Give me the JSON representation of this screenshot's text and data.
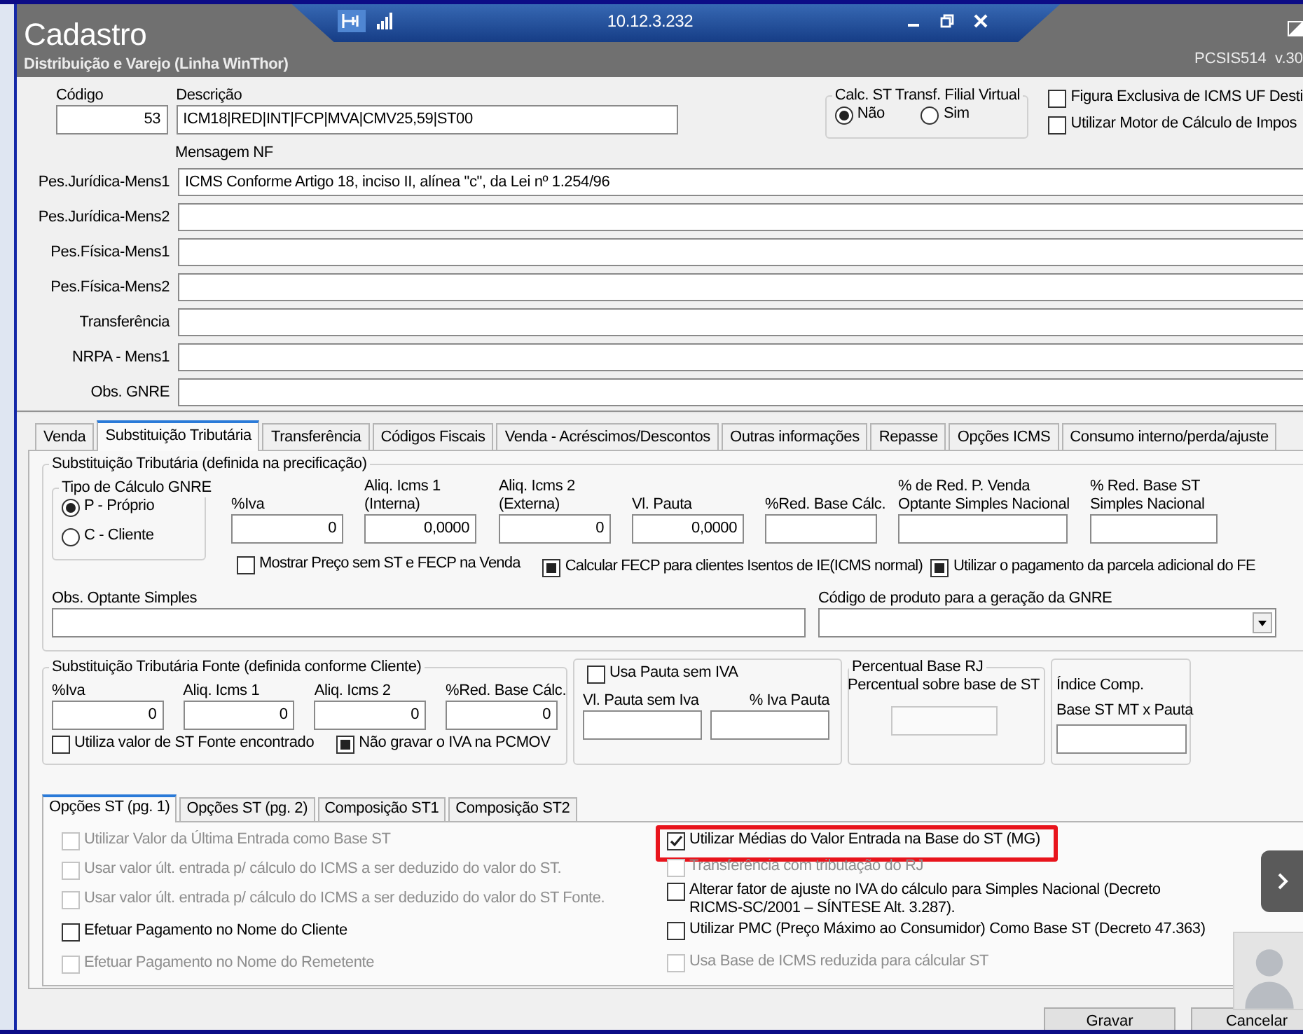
{
  "remote_session": {
    "host": "10.12.3.232"
  },
  "window": {
    "title": "Cadastro",
    "subtitle": "Distribuição e Varejo (Linha WinThor)",
    "routine": "PCSIS514  v.30"
  },
  "header": {
    "code": {
      "label": "Código",
      "value": "53"
    },
    "description": {
      "label": "Descrição",
      "value": "ICM18|RED|INT|FCP|MVA|CMV25,59|ST00"
    },
    "calc_st_transf": {
      "label": "Calc. ST Transf. Filial Virtual",
      "options": [
        {
          "label": "Não",
          "selected": true
        },
        {
          "label": "Sim",
          "selected": false
        }
      ]
    },
    "checks": [
      {
        "label": "Figura Exclusiva de ICMS UF Desti",
        "checked": false
      },
      {
        "label": "Utilizar Motor de Cálculo de Impos",
        "checked": false
      }
    ]
  },
  "messages": {
    "title": "Mensagem NF",
    "rows": [
      {
        "label": "Pes.Jurídica-Mens1",
        "value": "ICMS Conforme Artigo 18, inciso II, alínea \"c\", da Lei nº 1.254/96"
      },
      {
        "label": "Pes.Jurídica-Mens2"
      },
      {
        "label": "Pes.Física-Mens1"
      },
      {
        "label": "Pes.Física-Mens2"
      },
      {
        "label": "Transferência"
      },
      {
        "label": "NRPA - Mens1"
      },
      {
        "label": "Obs. GNRE"
      }
    ]
  },
  "tabs": [
    {
      "label": "Venda",
      "selected": false
    },
    {
      "label": "Substituição Tributária",
      "selected": true
    },
    {
      "label": "Transferência",
      "selected": false
    },
    {
      "label": "Códigos Fiscais",
      "selected": false
    },
    {
      "label": "Venda - Acréscimos/Descontos",
      "selected": false
    },
    {
      "label": "Outras informações",
      "selected": false
    },
    {
      "label": "Repasse",
      "selected": false
    },
    {
      "label": "Opções ICMS",
      "selected": false
    },
    {
      "label": "Consumo interno/perda/ajuste",
      "selected": false
    }
  ],
  "st": {
    "title": "Substituição Tributária (definida na precificação)",
    "gnre_type": {
      "label": "Tipo de Cálculo GNRE",
      "options": [
        {
          "label": "P - Próprio",
          "selected": true
        },
        {
          "label": "C - Cliente",
          "selected": false
        }
      ]
    },
    "fields": [
      {
        "label": "%Iva",
        "value": "0"
      },
      {
        "label": "Aliq. Icms 1\n(Interna)",
        "value": "0,0000"
      },
      {
        "label": "Aliq. Icms 2\n(Externa)",
        "value": "0"
      },
      {
        "label": "Vl. Pauta",
        "value": "0,0000"
      },
      {
        "label": "%Red. Base Cálc."
      },
      {
        "label": "% de Red. P. Venda\nOptante Simples Nacional"
      },
      {
        "label": "% Red. Base ST\nSimples Nacional"
      }
    ],
    "checks": [
      {
        "label": "Mostrar Preço sem ST e FECP na Venda",
        "checked": false
      },
      {
        "label": "Calcular FECP para clientes Isentos de IE(ICMS normal)",
        "checked": true
      },
      {
        "label": "Utilizar o pagamento da parcela adicional do FE",
        "checked": true
      }
    ],
    "obs": {
      "label": "Obs. Optante Simples"
    },
    "gnre_product": {
      "label": "Código de produto para a geração da GNRE"
    }
  },
  "fonte": {
    "title": "Substituição Tributária Fonte (definida conforme Cliente)",
    "fields": [
      {
        "label": "%Iva",
        "value": "0"
      },
      {
        "label": "Aliq. Icms 1",
        "value": "0"
      },
      {
        "label": "Aliq. Icms 2",
        "value": "0"
      },
      {
        "label": "%Red. Base Cálc.",
        "value": "0"
      }
    ],
    "checks": [
      {
        "label": "Utiliza valor de ST Fonte encontrado",
        "checked": false
      },
      {
        "label": "Não gravar o IVA na PCMOV",
        "checked": true
      }
    ]
  },
  "pauta": {
    "check": {
      "label": "Usa Pauta sem IVA",
      "checked": false
    },
    "fields": [
      {
        "label": "Vl. Pauta sem Iva"
      },
      {
        "label": "% Iva Pauta"
      }
    ]
  },
  "rj": {
    "title": "Percentual Base RJ",
    "field": {
      "label": "Percentual sobre base de ST",
      "disabled": true
    }
  },
  "index_comp": {
    "label": "Índice Comp.\nBase ST MT x Pauta"
  },
  "sub_tabs": [
    {
      "label": "Opções ST (pg. 1)",
      "selected": true
    },
    {
      "label": "Opções ST (pg. 2)",
      "selected": false
    },
    {
      "label": "Composição ST1",
      "selected": false
    },
    {
      "label": "Composição ST2",
      "selected": false
    }
  ],
  "options": {
    "left": [
      {
        "label": "Utilizar Valor da Última Entrada como Base ST",
        "checked": false,
        "disabled": true,
        "highlighted": false
      },
      {
        "label": "Usar valor últ. entrada p/ cálculo do ICMS a ser deduzido do valor do ST.",
        "checked": false,
        "disabled": true,
        "highlighted": false
      },
      {
        "label": "Usar valor últ. entrada p/ cálculo do ICMS a ser deduzido do valor do ST Fonte.",
        "checked": false,
        "disabled": true,
        "highlighted": false
      },
      {
        "label": "Efetuar Pagamento no Nome do Cliente",
        "checked": false,
        "disabled": false,
        "highlighted": false
      },
      {
        "label": "Efetuar Pagamento no Nome do Remetente",
        "checked": false,
        "disabled": true,
        "highlighted": false
      }
    ],
    "right": [
      {
        "label": "Utilizar Médias do Valor Entrada na Base do ST (MG)",
        "checked": true,
        "disabled": false,
        "highlighted": true
      },
      {
        "label": "Transferência com tributação do RJ",
        "checked": false,
        "disabled": true,
        "highlighted": false
      },
      {
        "label": "Alterar fator de ajuste no IVA do cálculo para Simples Nacional (Decreto\nRICMS-SC/2001 – SÍNTESE Alt. 3.287).",
        "checked": false,
        "disabled": false,
        "highlighted": false
      },
      {
        "label": "Utilizar PMC (Preço Máximo ao Consumidor) Como Base ST (Decreto 47.363)",
        "checked": false,
        "disabled": false,
        "highlighted": false
      },
      {
        "label": "Usa Base de ICMS reduzida para cálcular ST",
        "checked": false,
        "disabled": true,
        "highlighted": false
      }
    ]
  },
  "buttons": [
    "Gravar",
    "Cancelar"
  ]
}
